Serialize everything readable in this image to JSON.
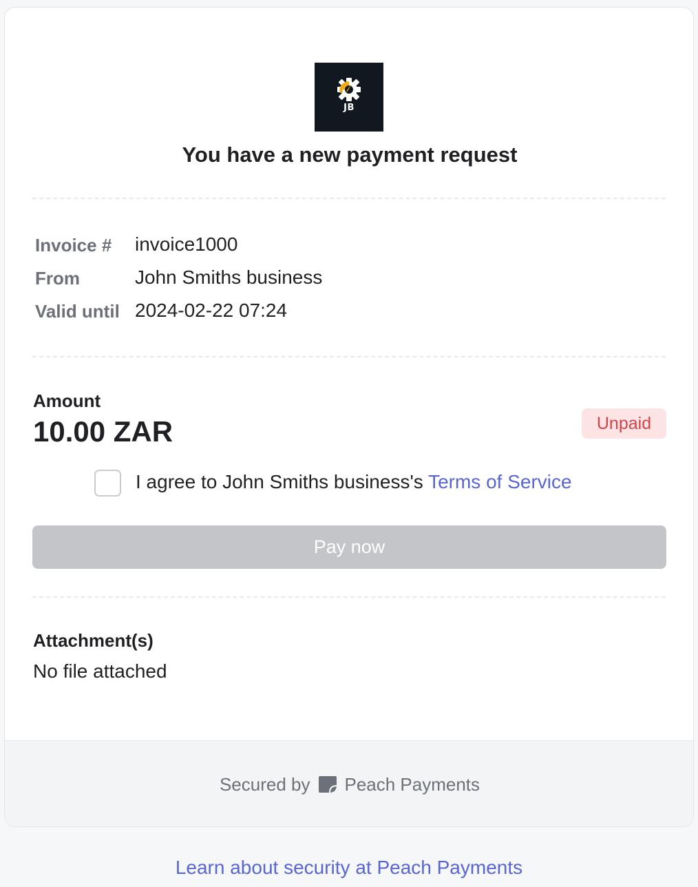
{
  "header": {
    "logo_initials": "JB",
    "title": "You have a new payment request"
  },
  "details": {
    "invoice_label": "Invoice #",
    "invoice_value": "invoice1000",
    "from_label": "From",
    "from_value": "John Smiths business",
    "valid_label": "Valid until",
    "valid_value": "2024-02-22 07:24"
  },
  "amount": {
    "label": "Amount",
    "value": "10.00 ZAR",
    "status": "Unpaid"
  },
  "terms": {
    "checked": false,
    "agree_text": "I agree to John Smiths business's ",
    "link_text": "Terms of Service"
  },
  "actions": {
    "pay_label": "Pay now"
  },
  "attachments": {
    "label": "Attachment(s)",
    "value": "No file attached"
  },
  "footer": {
    "secured_text": "Secured by",
    "brand": "Peach Payments",
    "learn_link": "Learn about security at Peach Payments"
  },
  "colors": {
    "accent": "#5865d2",
    "status_unpaid_bg": "#fde4e4",
    "status_unpaid_text": "#d0454b",
    "button_disabled": "#c3c5c9",
    "logo_bg": "#111820",
    "logo_gear_orange": "#f3a712"
  }
}
